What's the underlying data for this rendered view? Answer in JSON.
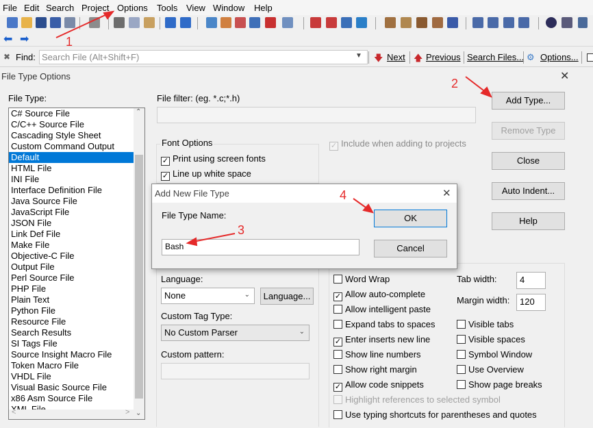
{
  "menu": [
    "File",
    "Edit",
    "Search",
    "Project",
    "Options",
    "Tools",
    "View",
    "Window",
    "Help"
  ],
  "find_bar": {
    "label": "Find:",
    "placeholder": "Search File (Alt+Shift+F)",
    "next": "Next",
    "previous": "Previous",
    "search_files": "Search Files...",
    "options": "Options..."
  },
  "dialog": {
    "title": "File Type Options",
    "file_type_label": "File Type:",
    "file_filter_label": "File filter: (eg. *.c;*.h)",
    "file_types": [
      "C# Source File",
      "C/C++ Source File",
      "Cascading Style Sheet",
      "Custom Command Output",
      "Default",
      "HTML File",
      "INI File",
      "Interface Definition File",
      "Java Source File",
      "JavaScript File",
      "JSON File",
      "Link Def File",
      "Make File",
      "Objective-C File",
      "Output File",
      "Perl Source File",
      "PHP File",
      "Plain Text",
      "Python File",
      "Resource File",
      "Search Results",
      "SI Tags File",
      "Source Insight Macro File",
      "Token Macro File",
      "VHDL File",
      "Visual Basic Source File",
      "x86 Asm Source File",
      "XML File"
    ],
    "selected_index": 4,
    "font_options": "Font Options",
    "print_screen_fonts": "Print using screen fonts",
    "line_up_white": "Line up white space",
    "include_projects": "Include when adding to projects",
    "buttons": {
      "add_type": "Add Type...",
      "remove_type": "Remove Type",
      "close": "Close",
      "auto_indent": "Auto Indent...",
      "help": "Help"
    },
    "language_label": "Language:",
    "language_value": "None",
    "language_button": "Language...",
    "custom_tag_label": "Custom Tag Type:",
    "custom_tag_value": "No Custom Parser",
    "custom_pattern_label": "Custom pattern:",
    "checks": {
      "word_wrap": "Word Wrap",
      "auto_complete": "Allow auto-complete",
      "intelligent_paste": "Allow intelligent paste",
      "expand_tabs": "Expand tabs to spaces",
      "enter_inserts": "Enter inserts new line",
      "show_line_numbers": "Show line numbers",
      "show_right_margin": "Show right margin",
      "code_snippets": "Allow code snippets",
      "highlight_refs": "Highlight references to selected symbol",
      "typing_shortcuts": "Use typing shortcuts for parentheses and quotes",
      "visible_tabs": "Visible tabs",
      "visible_spaces": "Visible spaces",
      "symbol_window": "Symbol Window",
      "use_overview": "Use Overview",
      "show_page_breaks": "Show page breaks"
    },
    "tab_width_label": "Tab width:",
    "tab_width_value": "4",
    "margin_width_label": "Margin width:",
    "margin_width_value": "120"
  },
  "add_dialog": {
    "title": "Add New File Type",
    "name_label": "File Type Name:",
    "name_value": "Bash",
    "ok": "OK",
    "cancel": "Cancel"
  },
  "annotations": [
    "1",
    "2",
    "3",
    "4"
  ],
  "accent_color": "#e52a2a",
  "selection_color": "#0078d7"
}
